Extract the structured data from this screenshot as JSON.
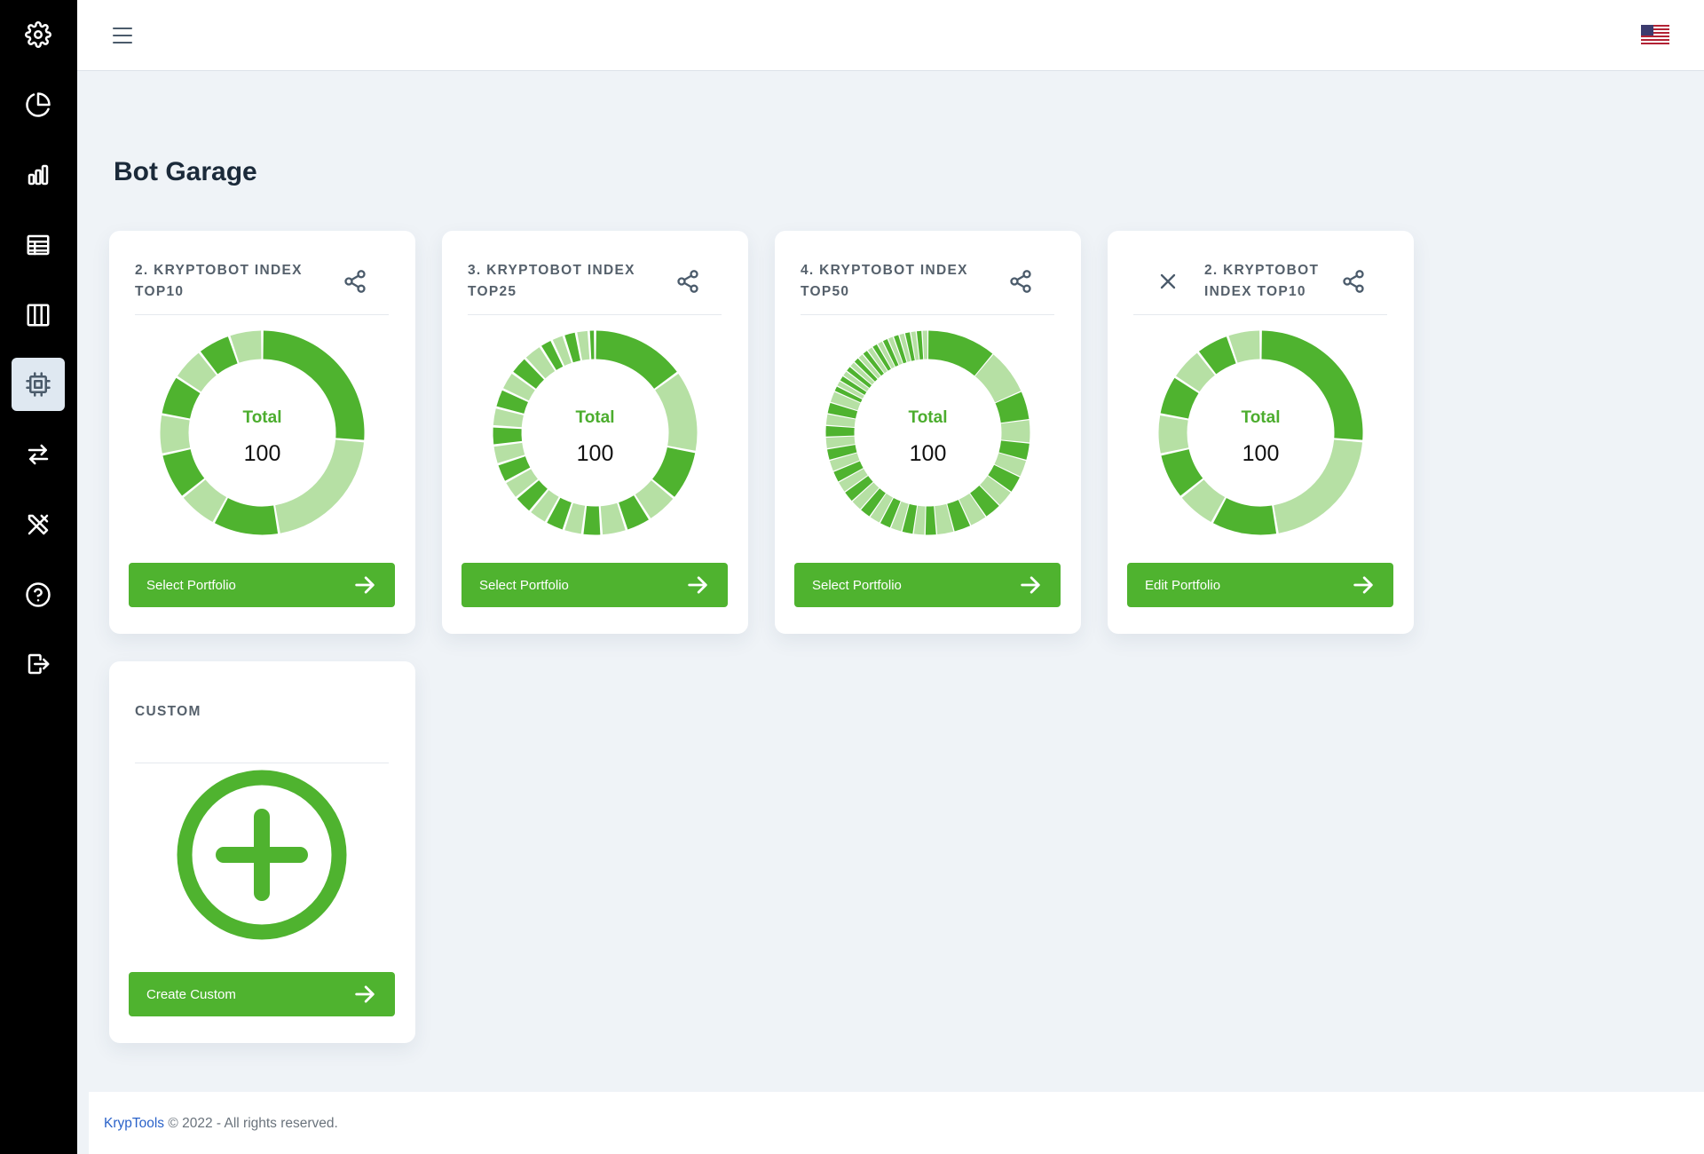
{
  "sidebar": {
    "items": [
      {
        "icon": "gear-icon"
      },
      {
        "icon": "pie-chart-icon"
      },
      {
        "icon": "bar-chart-icon"
      },
      {
        "icon": "table-icon"
      },
      {
        "icon": "columns-icon"
      },
      {
        "icon": "cpu-chip-icon",
        "active": true
      },
      {
        "icon": "swap-arrows-icon"
      },
      {
        "icon": "tools-icon"
      },
      {
        "icon": "help-circle-icon"
      },
      {
        "icon": "logout-icon"
      }
    ]
  },
  "header": {
    "menu_icon": "hamburger-menu-icon",
    "language_flag": "us-flag-icon"
  },
  "page": {
    "title": "Bot Garage"
  },
  "colors": {
    "dark_green": "#4fb32f",
    "light_green": "#b6e0a4",
    "accent_text": "#4cad2e"
  },
  "cards": [
    {
      "title": "2. KRYPTOBOT INDEX TOP10",
      "total_label": "Total",
      "total_value": "100",
      "button_label": "Select Portfolio",
      "has_close": false
    },
    {
      "title": "3. KRYPTOBOT INDEX TOP25",
      "total_label": "Total",
      "total_value": "100",
      "button_label": "Select Portfolio",
      "has_close": false
    },
    {
      "title": "4. KRYPTOBOT INDEX TOP50",
      "total_label": "Total",
      "total_value": "100",
      "button_label": "Select Portfolio",
      "has_close": false
    },
    {
      "title": "2. KRYPTOBOT INDEX TOP10",
      "total_label": "Total",
      "total_value": "100",
      "button_label": "Edit Portfolio",
      "has_close": true
    }
  ],
  "custom_card": {
    "title": "CUSTOM",
    "button_label": "Create Custom"
  },
  "chart_data": [
    {
      "type": "pie",
      "donut": true,
      "title": "",
      "center_label": "Total",
      "center_value": 100,
      "values": [
        25,
        20,
        10,
        6,
        7,
        6,
        6,
        5,
        5,
        5
      ]
    },
    {
      "type": "pie",
      "donut": true,
      "title": "",
      "center_label": "Total",
      "center_value": 100,
      "values": [
        15,
        13,
        8,
        5,
        4,
        4,
        3,
        3,
        3,
        3,
        3,
        3,
        3,
        3,
        3,
        3,
        3,
        3,
        3,
        3,
        2,
        2,
        2,
        2,
        1
      ]
    },
    {
      "type": "pie",
      "donut": true,
      "title": "",
      "center_label": "Total",
      "center_value": 100,
      "values": [
        12,
        8,
        5,
        4,
        3,
        3,
        3,
        3,
        3,
        3,
        3,
        3,
        2,
        2,
        2,
        2,
        2,
        2,
        2,
        2,
        2,
        2,
        2,
        2,
        2,
        2,
        2,
        2,
        2,
        2,
        1,
        1,
        1,
        1,
        1,
        1,
        1,
        1,
        1,
        1,
        1,
        1,
        1,
        1,
        1,
        1,
        1,
        1,
        1,
        1
      ]
    },
    {
      "type": "pie",
      "donut": true,
      "title": "",
      "center_label": "Total",
      "center_value": 100,
      "values": [
        25,
        20,
        10,
        6,
        7,
        6,
        6,
        5,
        5,
        5
      ]
    }
  ],
  "footer": {
    "brand": "KrypTools",
    "text": "© 2022 - All rights reserved."
  }
}
